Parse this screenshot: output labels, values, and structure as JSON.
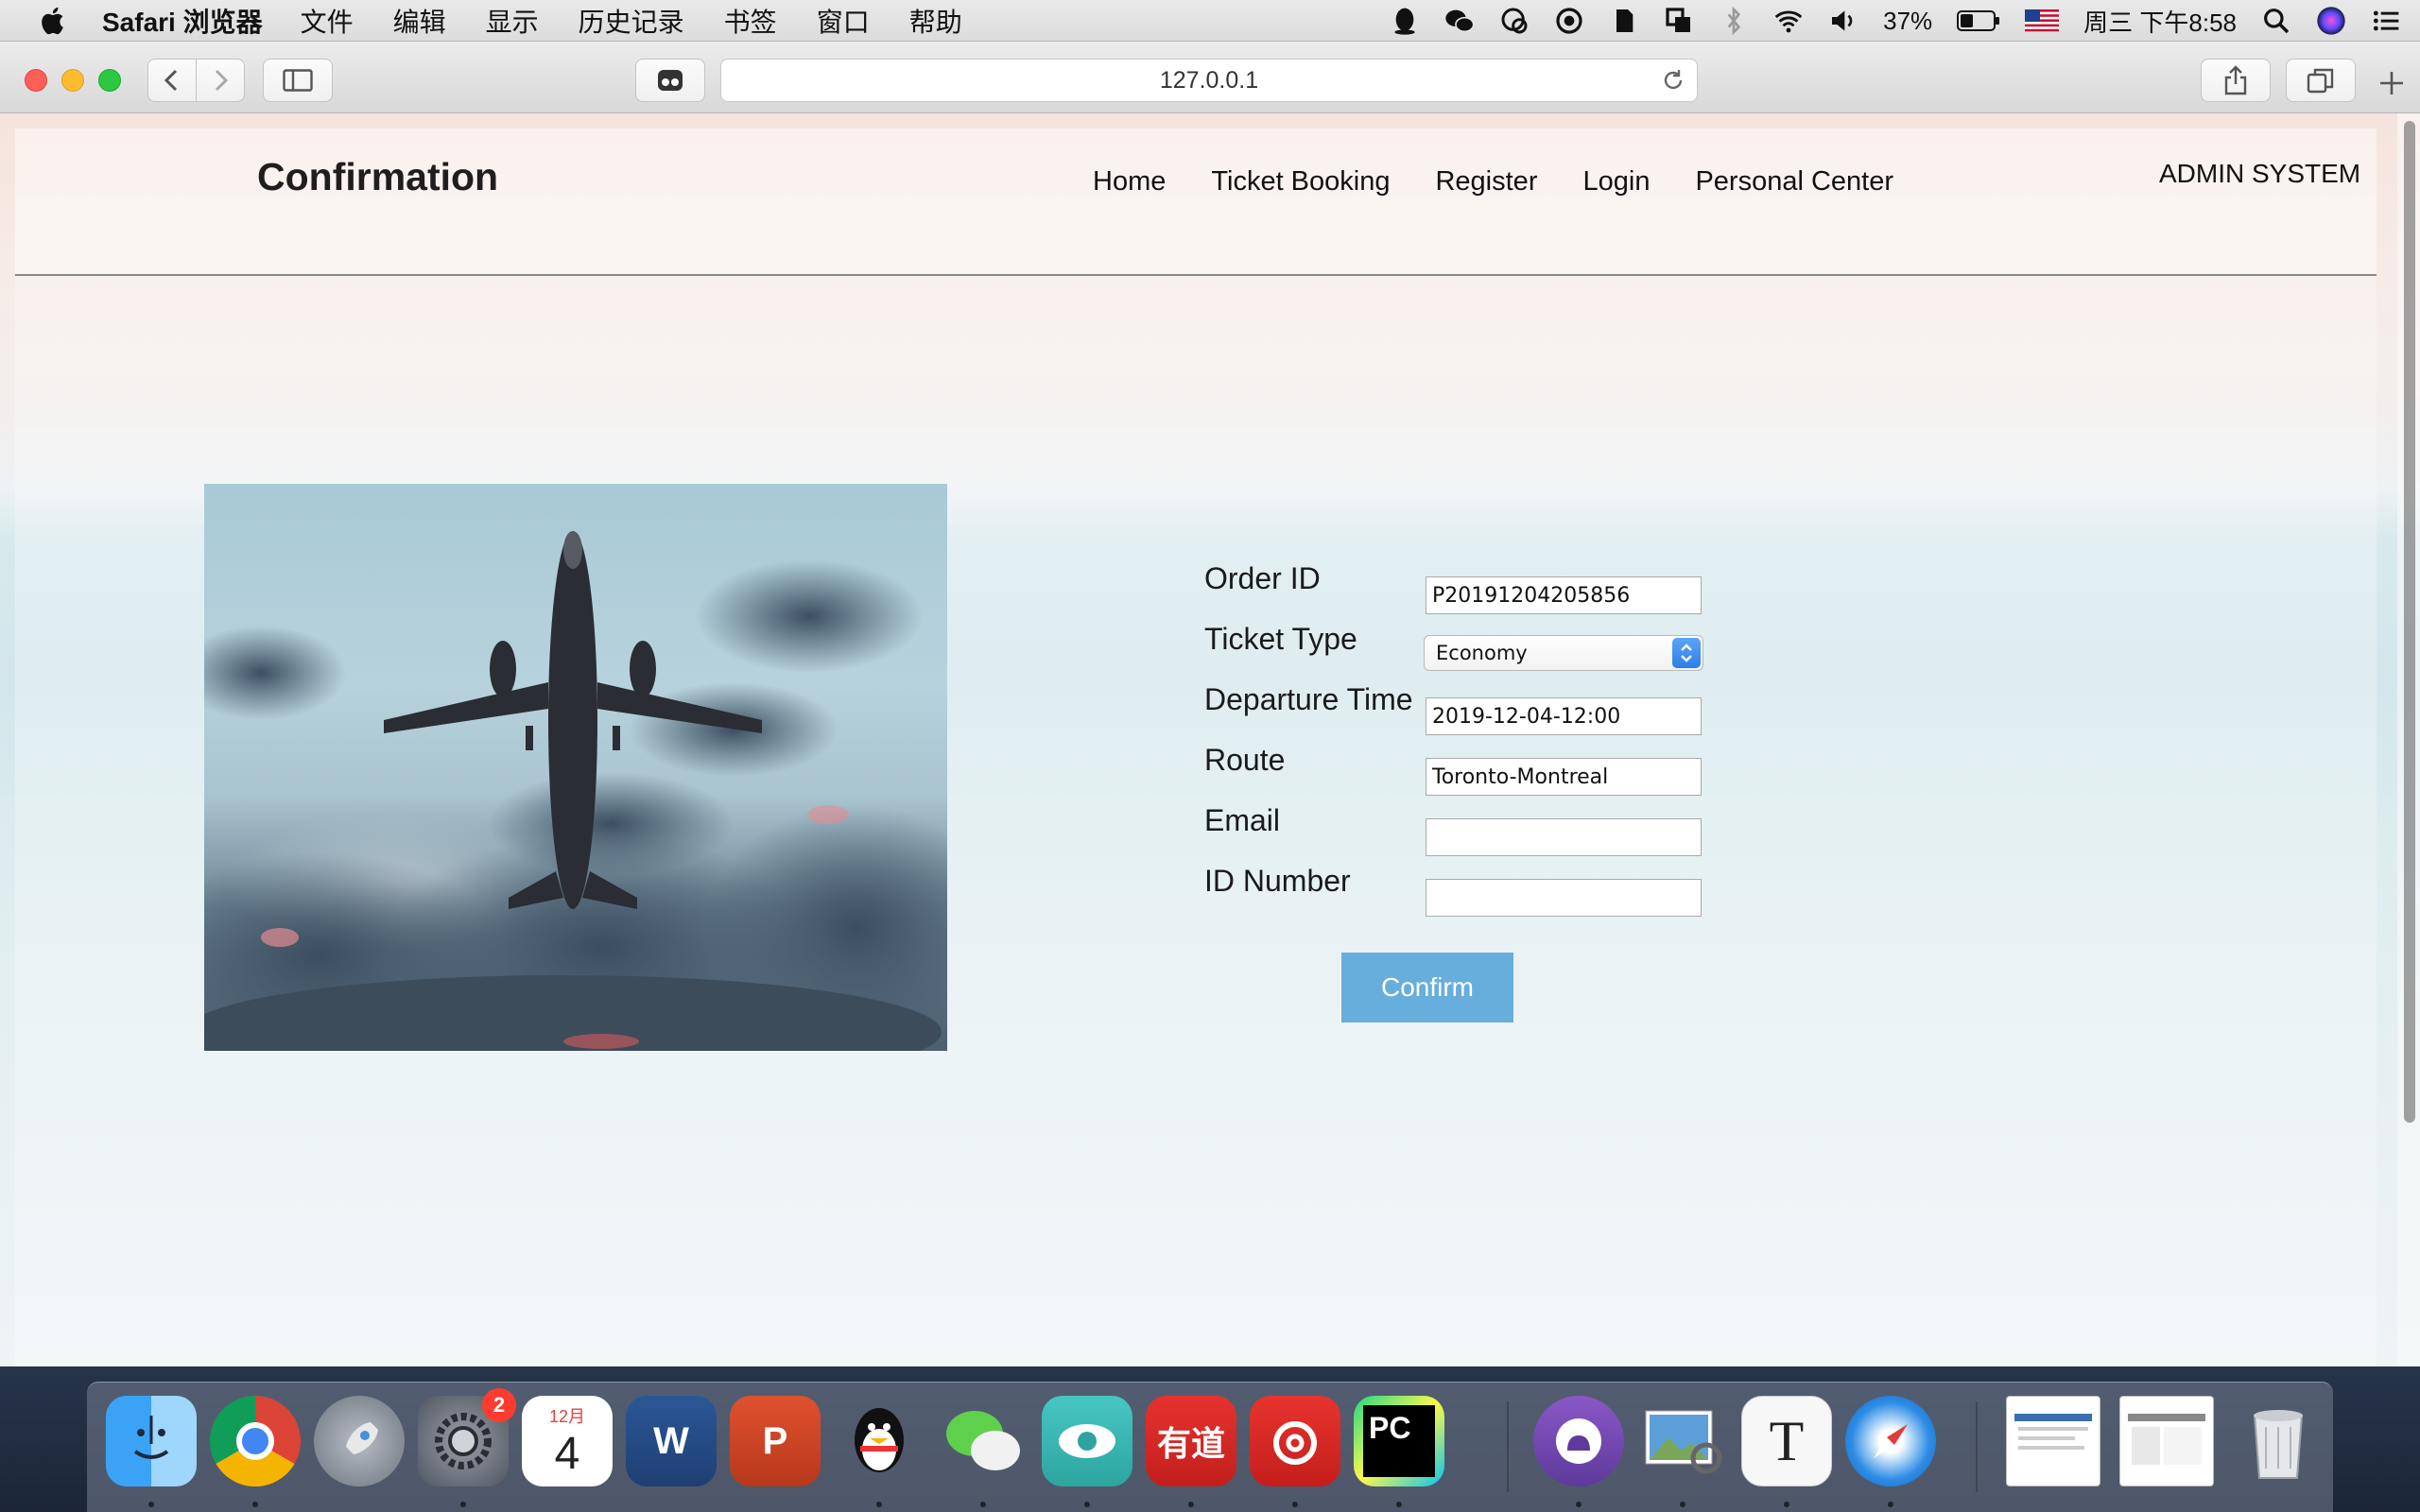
{
  "menubar": {
    "app_name": "Safari 浏览器",
    "items": [
      "文件",
      "编辑",
      "显示",
      "历史记录",
      "书签",
      "窗口",
      "帮助"
    ],
    "battery": "37%",
    "clock": "周三 下午8:58"
  },
  "browser": {
    "url": "127.0.0.1"
  },
  "page": {
    "title": "Confirmation",
    "nav": [
      "Home",
      "Ticket Booking",
      "Register",
      "Login",
      "Personal Center"
    ],
    "admin_link": "ADMIN SYSTEM"
  },
  "form": {
    "labels": {
      "order_id": "Order ID",
      "ticket_type": "Ticket Type",
      "departure_time": "Departure Time",
      "route": "Route",
      "email": "Email",
      "id_number": "ID Number"
    },
    "values": {
      "order_id": "P20191204205856",
      "ticket_type": "Economy",
      "departure_time": "2019-12-04-12:00",
      "route": "Toronto-Montreal",
      "email": "",
      "id_number": ""
    },
    "confirm_label": "Confirm"
  },
  "dock": {
    "calendar_month": "12月",
    "calendar_day": "4",
    "badge_count": "2",
    "word_letter": "W",
    "ppt_letter": "P",
    "youdao_text": "有道",
    "pycharm_text": "PC",
    "typora_letter": "T"
  },
  "colors": {
    "confirm_button": "#68aedc",
    "select_arrow": "#2d7fe6",
    "traffic_red": "#fc5f57",
    "traffic_yellow": "#fdbc2e",
    "traffic_green": "#2bc840"
  }
}
